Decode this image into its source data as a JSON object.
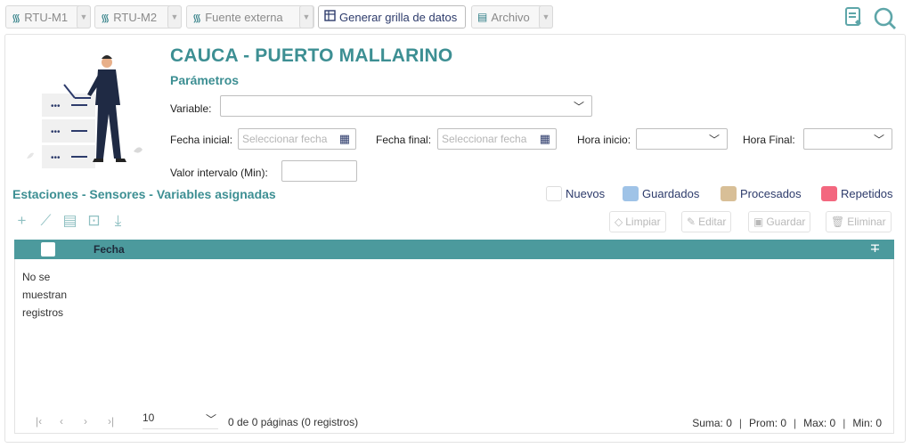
{
  "toolbar": {
    "rtu1_label": "RTU-M1",
    "rtu2_label": "RTU-M2",
    "external_label": "Fuente externa",
    "generate_label": "Generar grilla de datos",
    "file_label": "Archivo"
  },
  "header": {
    "title": "CAUCA - PUERTO MALLARINO",
    "subtitle": "Parámetros"
  },
  "form": {
    "variable_label": "Variable:",
    "variable_value": "",
    "start_date_label": "Fecha inicial:",
    "start_date_placeholder": "Seleccionar fecha",
    "end_date_label": "Fecha final:",
    "end_date_placeholder": "Seleccionar fecha",
    "start_time_label": "Hora inicio:",
    "end_time_label": "Hora Final:",
    "interval_label": "Valor intervalo (Min):",
    "interval_value": ""
  },
  "section": {
    "title": "Estaciones - Sensores - Variables asignadas"
  },
  "legend": [
    {
      "label": "Nuevos",
      "color": "#ffffff"
    },
    {
      "label": "Guardados",
      "color": "#9fc3e7"
    },
    {
      "label": "Procesados",
      "color": "#d8bf97"
    },
    {
      "label": "Repetidos",
      "color": "#f3677f"
    }
  ],
  "actions": {
    "clear_label": "Limpiar",
    "edit_label": "Editar",
    "save_label": "Guardar",
    "delete_label": "Eliminar"
  },
  "grid": {
    "column_date": "Fecha",
    "empty_message": "No se muestran registros",
    "header_color": "#4c9a9d"
  },
  "pager": {
    "page_size": "10",
    "page_info": "0 de 0 páginas (0 registros)"
  },
  "stats": {
    "sum": "Suma: 0",
    "avg": "Prom: 0",
    "max": "Max: 0",
    "min": "Min: 0"
  },
  "colors": {
    "accent": "#3d8f93",
    "navy": "#2d3b6b"
  }
}
